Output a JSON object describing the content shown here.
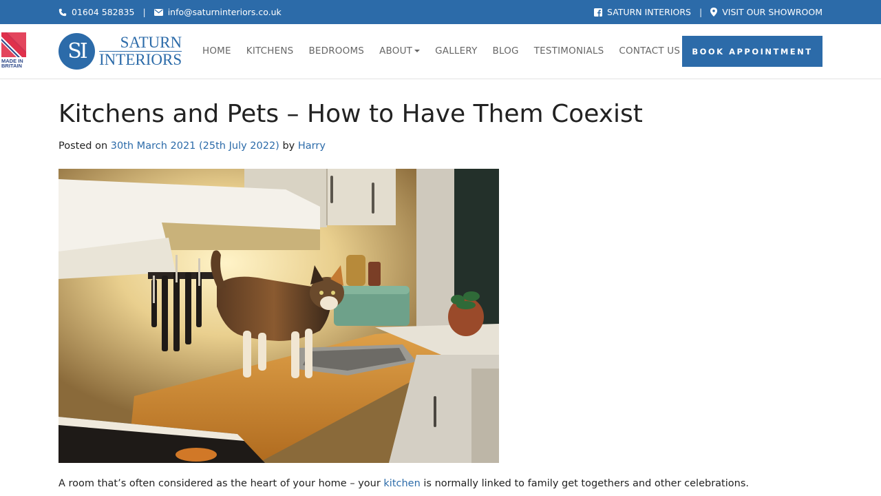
{
  "topbar": {
    "phone": "01604 582835",
    "email": "info@saturninteriors.co.uk",
    "facebook_label": "SATURN INTERIORS",
    "showroom_label": "VISIT OUR SHOWROOM",
    "separator": "|"
  },
  "header": {
    "flag_text": [
      "MADE IN",
      "BRITAIN"
    ],
    "logo_mark": "SI",
    "logo_line1": "SATURN",
    "logo_line2": "INTERIORS",
    "nav": [
      "HOME",
      "KITCHENS",
      "BEDROOMS",
      "ABOUT",
      "GALLERY",
      "BLOG",
      "TESTIMONIALS",
      "CONTACT US"
    ],
    "book_button": "BOOK APPOINTMENT"
  },
  "article": {
    "title": "Kitchens and Pets – How to Have Them Coexist",
    "posted_on": "Posted on",
    "date": "30th March 2021 (25th July 2022)",
    "by": "by",
    "author": "Harry",
    "intro_before": "A room that’s often considered as the heart of your home – your",
    "intro_link": "kitchen",
    "intro_after": "is normally linked to family get togethers and other celebrations."
  },
  "colors": {
    "brand_blue": "#2c6ba9",
    "nav_text": "#666666"
  }
}
